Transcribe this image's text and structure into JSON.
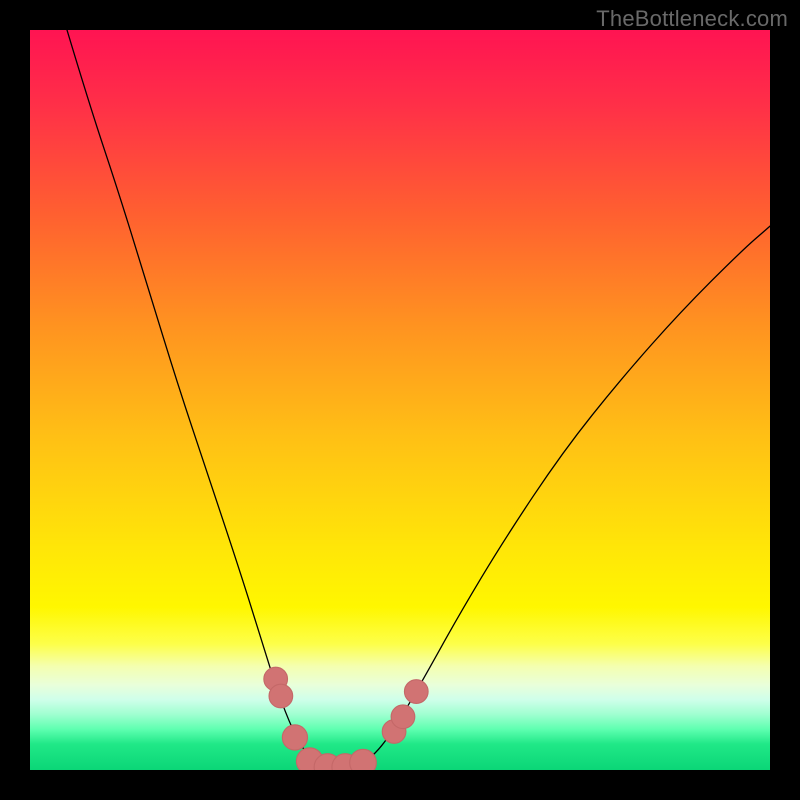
{
  "watermark": "TheBottleneck.com",
  "colors": {
    "black": "#000000",
    "gradient_stops": [
      {
        "offset": 0.0,
        "color": "#ff1452"
      },
      {
        "offset": 0.1,
        "color": "#ff2f48"
      },
      {
        "offset": 0.25,
        "color": "#ff6030"
      },
      {
        "offset": 0.4,
        "color": "#ff9320"
      },
      {
        "offset": 0.55,
        "color": "#ffc015"
      },
      {
        "offset": 0.7,
        "color": "#ffe608"
      },
      {
        "offset": 0.78,
        "color": "#fff700"
      },
      {
        "offset": 0.83,
        "color": "#fdff4a"
      },
      {
        "offset": 0.86,
        "color": "#f4ffb0"
      },
      {
        "offset": 0.885,
        "color": "#e9ffda"
      },
      {
        "offset": 0.905,
        "color": "#cfffea"
      },
      {
        "offset": 0.925,
        "color": "#9fffd0"
      },
      {
        "offset": 0.945,
        "color": "#5effb0"
      },
      {
        "offset": 0.965,
        "color": "#20e887"
      },
      {
        "offset": 1.0,
        "color": "#0bd677"
      }
    ],
    "curve": "#000000",
    "marker_fill": "#d17373",
    "marker_stroke": "#c46868"
  },
  "chart_data": {
    "type": "line",
    "title": "",
    "xlabel": "",
    "ylabel": "",
    "xlim": [
      0,
      100
    ],
    "ylim": [
      0,
      100
    ],
    "series": [
      {
        "name": "bottleneck-curve",
        "points": [
          {
            "x": 5.0,
            "y": 100.0
          },
          {
            "x": 8.0,
            "y": 90.0
          },
          {
            "x": 12.0,
            "y": 78.0
          },
          {
            "x": 16.0,
            "y": 65.0
          },
          {
            "x": 20.0,
            "y": 52.0
          },
          {
            "x": 24.0,
            "y": 40.0
          },
          {
            "x": 28.0,
            "y": 28.0
          },
          {
            "x": 31.0,
            "y": 18.5
          },
          {
            "x": 33.0,
            "y": 12.0
          },
          {
            "x": 35.0,
            "y": 6.5
          },
          {
            "x": 37.0,
            "y": 2.5
          },
          {
            "x": 39.5,
            "y": 0.5
          },
          {
            "x": 42.0,
            "y": 0.0
          },
          {
            "x": 44.5,
            "y": 0.5
          },
          {
            "x": 47.0,
            "y": 2.5
          },
          {
            "x": 49.5,
            "y": 6.0
          },
          {
            "x": 53.0,
            "y": 12.0
          },
          {
            "x": 58.0,
            "y": 21.0
          },
          {
            "x": 64.0,
            "y": 31.0
          },
          {
            "x": 72.0,
            "y": 43.0
          },
          {
            "x": 80.0,
            "y": 53.0
          },
          {
            "x": 88.0,
            "y": 62.0
          },
          {
            "x": 96.0,
            "y": 70.0
          },
          {
            "x": 100.0,
            "y": 73.5
          }
        ]
      }
    ],
    "markers": [
      {
        "x": 33.2,
        "y": 12.3,
        "r": 1.6
      },
      {
        "x": 33.9,
        "y": 10.0,
        "r": 1.6
      },
      {
        "x": 35.8,
        "y": 4.4,
        "r": 1.7
      },
      {
        "x": 37.8,
        "y": 1.2,
        "r": 1.8
      },
      {
        "x": 40.2,
        "y": 0.4,
        "r": 1.8
      },
      {
        "x": 42.6,
        "y": 0.4,
        "r": 1.8
      },
      {
        "x": 45.0,
        "y": 1.0,
        "r": 1.8
      },
      {
        "x": 49.2,
        "y": 5.2,
        "r": 1.6
      },
      {
        "x": 50.4,
        "y": 7.2,
        "r": 1.6
      },
      {
        "x": 52.2,
        "y": 10.6,
        "r": 1.6
      }
    ]
  }
}
